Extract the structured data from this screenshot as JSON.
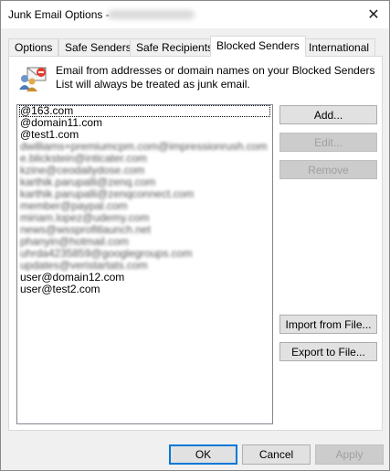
{
  "window": {
    "title": "Junk Email Options - ",
    "close_glyph": "✕"
  },
  "tabs": [
    {
      "label": "Options"
    },
    {
      "label": "Safe Senders"
    },
    {
      "label": "Safe Recipients"
    },
    {
      "label": "Blocked Senders",
      "active": true
    },
    {
      "label": "International"
    }
  ],
  "panel": {
    "description": "Email from addresses or domain names on your Blocked Senders List will always be treated as junk email.",
    "icon": "blocked-senders-icon"
  },
  "blocked_list": [
    "@163.com",
    "@domain11.com",
    "@test1.com",
    "dwilliams+premiumcpm.com@impressionrush.com",
    "e.blickstein@inticater.com",
    "kzine@ceodailydose.com",
    "karthik.parupalli@zenq.com",
    "karthik.parupalli@zenqconnect.com",
    "member@paypal.com",
    "miriam.lopez@udemy.com",
    "news@wssprofitlaunch.net",
    "phanyin@hotmail.com",
    "uhrda4235859@googlegroups.com",
    "updates@veristartats.com",
    "user@domain12.com",
    "user@test2.com"
  ],
  "blurred_rows": [
    3,
    4,
    5,
    6,
    7,
    8,
    9,
    10,
    11,
    12,
    13
  ],
  "side_buttons": {
    "add": "Add...",
    "edit": "Edit...",
    "remove": "Remove",
    "import": "Import from File...",
    "export": "Export to File..."
  },
  "footer": {
    "ok": "OK",
    "cancel": "Cancel",
    "apply": "Apply"
  }
}
